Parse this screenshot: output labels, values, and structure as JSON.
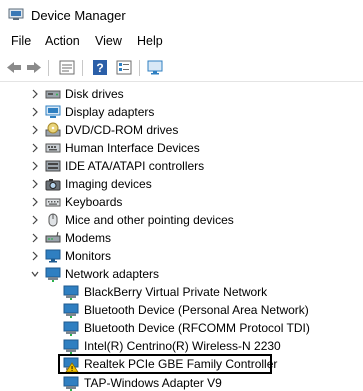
{
  "window": {
    "title": "Device Manager"
  },
  "menu": [
    "File",
    "Action",
    "View",
    "Help"
  ],
  "toolbar": {
    "buttons": [
      "back-icon",
      "forward-icon",
      "properties-icon",
      "help-icon",
      "details-icon",
      "monitor-icon"
    ]
  },
  "tree": {
    "categories": [
      {
        "label": "Disk drives",
        "icon": "disk-drive-icon"
      },
      {
        "label": "Display adapters",
        "icon": "display-adapter-icon"
      },
      {
        "label": "DVD/CD-ROM drives",
        "icon": "dvd-drive-icon"
      },
      {
        "label": "Human Interface Devices",
        "icon": "hid-icon"
      },
      {
        "label": "IDE ATA/ATAPI controllers",
        "icon": "ide-controller-icon"
      },
      {
        "label": "Imaging devices",
        "icon": "camera-icon"
      },
      {
        "label": "Keyboards",
        "icon": "keyboard-icon"
      },
      {
        "label": "Mice and other pointing devices",
        "icon": "mouse-icon"
      },
      {
        "label": "Modems",
        "icon": "modem-icon"
      },
      {
        "label": "Monitors",
        "icon": "monitor-icon"
      },
      {
        "label": "Network adapters",
        "icon": "network-adapter-icon",
        "expanded": true
      }
    ],
    "network_children": [
      {
        "label": "BlackBerry Virtual Private Network",
        "warning": false
      },
      {
        "label": "Bluetooth Device (Personal Area Network)",
        "warning": false
      },
      {
        "label": "Bluetooth Device (RFCOMM Protocol TDI)",
        "warning": false
      },
      {
        "label": "Intel(R) Centrino(R) Wireless-N 2230",
        "warning": false
      },
      {
        "label": "Realtek PCIe GBE Family Controller",
        "warning": true,
        "selected": true
      },
      {
        "label": "TAP-Windows Adapter V9",
        "warning": false
      }
    ]
  },
  "colors": {
    "icon_blue": "#2f7fc1",
    "chevron": "#444444",
    "warning": "#f2c200",
    "selection_border": "#000000"
  }
}
